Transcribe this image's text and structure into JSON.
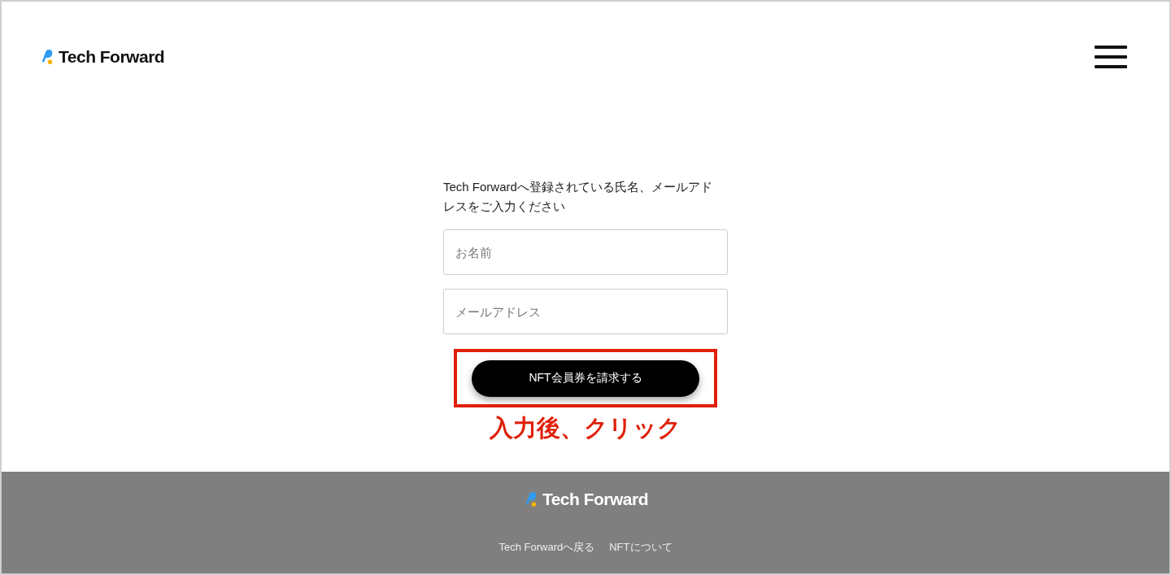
{
  "header": {
    "logo": "Tech Forward"
  },
  "form": {
    "instruction": "Tech Forwardへ登録されている氏名、メールアドレスをご入力ください",
    "fields": [
      {
        "placeholder": "お名前"
      },
      {
        "placeholder": "メールアドレス"
      }
    ],
    "submit": "NFT会員券を請求する",
    "annotation": "入力後、クリック"
  },
  "footer": {
    "logo": "Tech Forward",
    "links": [
      "Tech Forwardへ戻る",
      "NFTについて"
    ]
  }
}
